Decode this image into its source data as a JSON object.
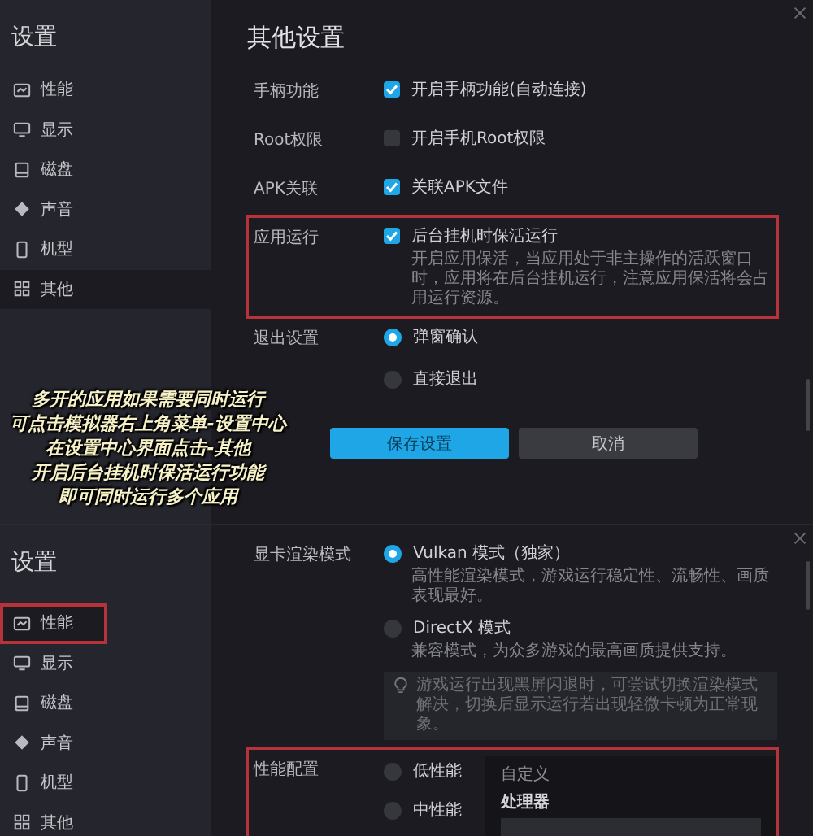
{
  "top_panel": {
    "sidebar": {
      "title": "设置",
      "items": [
        {
          "label": "性能",
          "selected": false,
          "highlighted": false
        },
        {
          "label": "显示",
          "selected": false,
          "highlighted": false
        },
        {
          "label": "磁盘",
          "selected": false,
          "highlighted": false
        },
        {
          "label": "声音",
          "selected": false,
          "highlighted": false
        },
        {
          "label": "机型",
          "selected": false,
          "highlighted": false
        },
        {
          "label": "其他",
          "selected": true,
          "highlighted": false
        }
      ]
    },
    "title": "其他设置",
    "rows": [
      {
        "kind": "checkbox",
        "label": "手柄功能",
        "option": "开启手柄功能(自动连接)",
        "checked": true,
        "highlighted": false
      },
      {
        "kind": "checkbox",
        "label": "Root权限",
        "option": "开启手机Root权限",
        "checked": false,
        "highlighted": false
      },
      {
        "kind": "checkbox",
        "label": "APK关联",
        "option": "关联APK文件",
        "checked": true,
        "highlighted": false
      },
      {
        "kind": "checkbox",
        "label": "应用运行",
        "option": "后台挂机时保活运行",
        "checked": true,
        "highlighted": true,
        "description": "开启应用保活，当应用处于非主操作的活跃窗口时，应用将在后台挂机运行，注意应用保活将会占用运行资源。"
      },
      {
        "kind": "radio",
        "label": "退出设置",
        "highlighted": false,
        "options": [
          {
            "label": "弹窗确认",
            "selected": true
          },
          {
            "label": "直接退出",
            "selected": false
          }
        ]
      }
    ],
    "buttons": [
      {
        "label": "保存设置",
        "kind": "primary"
      },
      {
        "label": "取消",
        "kind": "secondary"
      }
    ]
  },
  "caption": {
    "lines": [
      "多开的应用如果需要同时运行",
      "可点击模拟器右上角菜单-设置中心",
      "在设置中心界面点击-其他",
      "开启后台挂机时保活运行功能",
      "即可同时运行多个应用"
    ]
  },
  "bottom_panel": {
    "sidebar": {
      "title": "设置",
      "items": [
        {
          "label": "性能",
          "selected": true,
          "highlighted": true
        },
        {
          "label": "显示",
          "selected": false,
          "highlighted": false
        },
        {
          "label": "磁盘",
          "selected": false,
          "highlighted": false
        },
        {
          "label": "声音",
          "selected": false,
          "highlighted": false
        },
        {
          "label": "机型",
          "selected": false,
          "highlighted": false
        },
        {
          "label": "其他",
          "selected": false,
          "highlighted": false
        }
      ]
    },
    "rows": [
      {
        "kind": "radio",
        "label": "显卡渲染模式",
        "highlighted": false,
        "options": [
          {
            "label": "Vulkan 模式（独家）",
            "description": "高性能渲染模式，游戏运行稳定性、流畅性、画质表现最好。",
            "selected": true
          },
          {
            "label": "DirectX 模式",
            "description": "兼容模式，为众多游戏的最高画质提供支持。",
            "selected": false
          }
        ],
        "hint": "游戏运行出现黑屏闪退时，可尝试切换渲染模式解决，切换后显示运行若出现轻微卡顿为正常现象。"
      },
      {
        "kind": "performance",
        "label": "性能配置",
        "highlighted": true,
        "options": [
          {
            "label": "低性能",
            "selected": false
          },
          {
            "label": "中性能",
            "selected": false
          }
        ],
        "custom": {
          "title": "自定义",
          "field_label": "处理器"
        }
      }
    ]
  }
}
